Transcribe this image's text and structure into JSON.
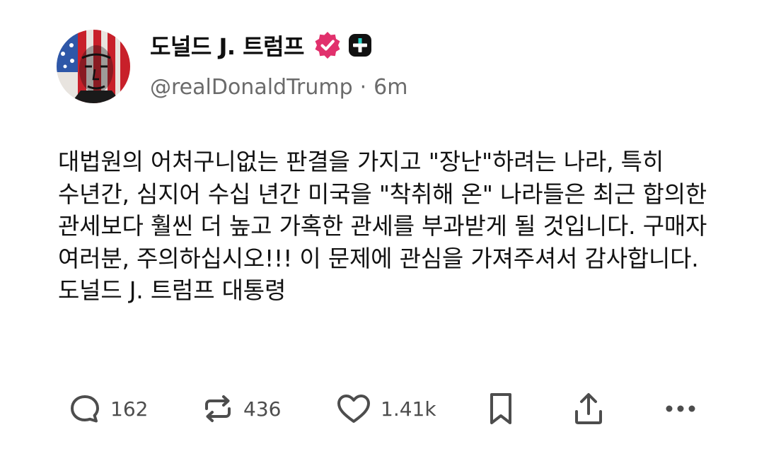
{
  "author": {
    "display_name": "도널드 J. 트럼프",
    "handle": "@realDonaldTrump",
    "separator": "·",
    "time_ago": "6m",
    "verified_icon": "verified-badge-icon",
    "verified_color": "#e1306c",
    "plus_icon": "plus-app-icon"
  },
  "post": {
    "text": "대법원의 어처구니없는 판결을 가지고 \"장난\"하려는 나라, 특히 수년간, 심지어 수십 년간 미국을 \"착취해 온\" 나라들은 최근 합의한 관세보다 훨씬 더 높고 가혹한 관세를 부과받게 될 것입니다. 구매자 여러분, 주의하십시오!!! 이 문제에 관심을 가져주셔서 감사합니다. 도널드 J. 트럼프 대통령"
  },
  "actions": {
    "reply": {
      "icon": "reply-bubble-icon",
      "count": "162"
    },
    "repost": {
      "icon": "repost-icon",
      "count": "436"
    },
    "like": {
      "icon": "heart-icon",
      "count": "1.41k"
    },
    "bookmark": {
      "icon": "bookmark-icon"
    },
    "share": {
      "icon": "share-icon"
    },
    "more": {
      "icon": "more-dots-icon"
    }
  },
  "colors": {
    "text": "#121212",
    "muted": "#6b6b6b",
    "icon": "#4d4d4d",
    "verified": "#e1306c"
  }
}
